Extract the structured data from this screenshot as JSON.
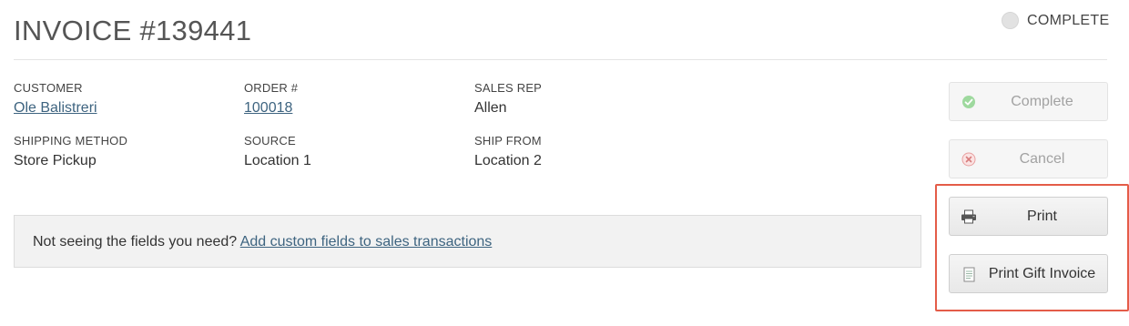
{
  "header": {
    "title": "INVOICE #139441",
    "status": "COMPLETE"
  },
  "details": {
    "customer": {
      "label": "CUSTOMER",
      "value": "Ole Balistreri"
    },
    "order": {
      "label": "ORDER #",
      "value": "100018"
    },
    "sales_rep": {
      "label": "SALES REP",
      "value": "Allen"
    },
    "shipping_method": {
      "label": "SHIPPING METHOD",
      "value": "Store Pickup"
    },
    "source": {
      "label": "SOURCE",
      "value": "Location 1"
    },
    "ship_from": {
      "label": "SHIP FROM",
      "value": "Location 2"
    }
  },
  "notice": {
    "text": "Not seeing the fields you need?",
    "link": "Add custom fields to sales transactions"
  },
  "actions": {
    "complete": {
      "label": "Complete",
      "icon": "check-circle-icon",
      "enabled": false
    },
    "cancel": {
      "label": "Cancel",
      "icon": "x-circle-icon",
      "enabled": false
    },
    "print": {
      "label": "Print",
      "icon": "printer-icon",
      "enabled": true
    },
    "print_gift": {
      "label": "Print Gift Invoice",
      "icon": "document-icon",
      "enabled": true
    }
  },
  "colors": {
    "link": "#3e6480",
    "highlight": "#e45c48",
    "success": "#7fcf7f",
    "danger": "#e08a8a"
  }
}
